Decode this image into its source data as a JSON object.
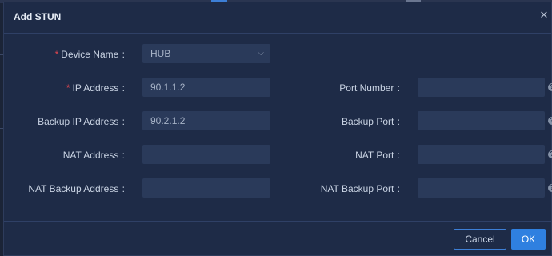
{
  "dialog": {
    "title": "Add STUN",
    "close_icon": "close-icon"
  },
  "fields": {
    "device_name": {
      "label": "Device Name",
      "required": true,
      "value": "HUB"
    },
    "ip_address": {
      "label": "IP Address",
      "required": true,
      "value": "90.1.1.2"
    },
    "port_number": {
      "label": "Port Number",
      "value": ""
    },
    "backup_ip_address": {
      "label": "Backup IP Address",
      "value": "90.2.1.2"
    },
    "backup_port": {
      "label": "Backup Port",
      "value": ""
    },
    "nat_address": {
      "label": "NAT Address",
      "value": ""
    },
    "nat_port": {
      "label": "NAT Port",
      "value": ""
    },
    "nat_backup_address": {
      "label": "NAT Backup Address",
      "value": ""
    },
    "nat_backup_port": {
      "label": "NAT Backup Port",
      "value": ""
    }
  },
  "footer": {
    "cancel_label": "Cancel",
    "ok_label": "OK"
  },
  "colors": {
    "dialog_bg": "#1e2b47",
    "field_bg": "#2a3a5a",
    "accent": "#2f80e0",
    "required": "#e0464f"
  }
}
